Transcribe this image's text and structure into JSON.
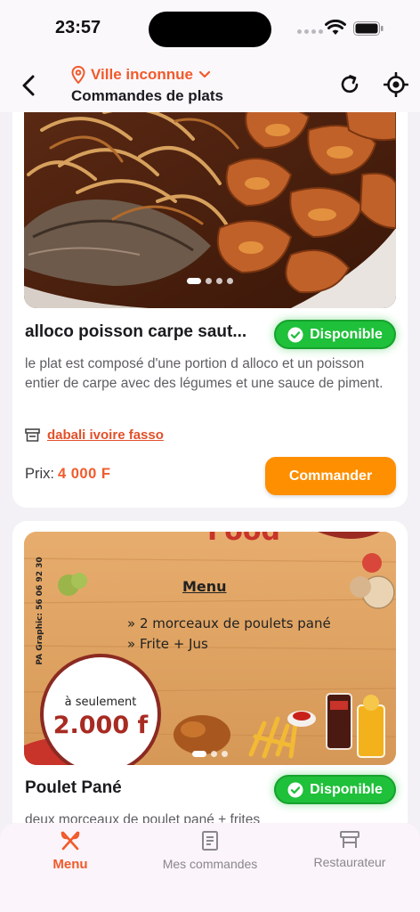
{
  "status_bar": {
    "time": "23:57"
  },
  "header": {
    "location": "Ville inconnue",
    "title": "Commandes de plats"
  },
  "dishes": [
    {
      "title": "alloco poisson carpe saut...",
      "badge": "Disponible",
      "description": "le plat est  composé d'une portion d alloco et un poisson entier de carpe avec des légumes et une sauce de piment.",
      "restaurant": "dabali ivoire fasso",
      "price_label": "Prix:",
      "price": "4 000 F",
      "order_label": "Commander"
    },
    {
      "title": "Poulet Pané",
      "badge": "Disponible",
      "description": "deux morceaux de poulet pané + frites"
    }
  ],
  "poster": {
    "heading": "Food",
    "menu_title": "Menu",
    "line1": "» 2 morceaux de poulets pané",
    "line2": "» Frite + Jus",
    "side_text": "PA Graphic: 56 06 92 30",
    "offer_label": "à seulement",
    "offer_price": "2.000 f"
  },
  "bottom_nav": [
    {
      "label": "Menu",
      "icon": "fork-knife-icon",
      "active": true
    },
    {
      "label": "Mes commandes",
      "icon": "receipt-icon",
      "active": false
    },
    {
      "label": "Restaurateur",
      "icon": "stall-icon",
      "active": false
    }
  ],
  "colors": {
    "accent": "#f15a2b",
    "order_button": "#fd8f00",
    "available_badge": "#1fc03a"
  }
}
